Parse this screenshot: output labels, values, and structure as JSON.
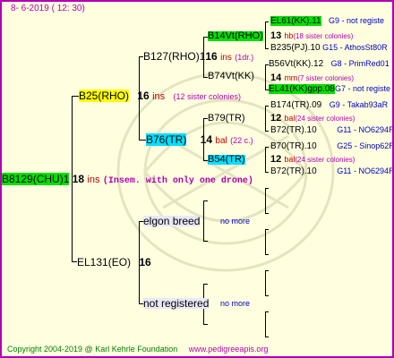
{
  "header": {
    "date": "8-  6-2019 ( 12:  30)"
  },
  "footer": {
    "copyright": "Copyright 2004-2019 @ Karl Kehrle Foundation",
    "site": "www.pedigreeapis.org"
  },
  "colors": {
    "frame": "#b000b0",
    "background": "#ffffe0",
    "highlight_green": "#00e000",
    "highlight_yellow": "#ffff00",
    "highlight_cyan": "#00e0ff",
    "link_blue": "#0000c0"
  },
  "root": {
    "id": "B8129(CHU)1",
    "num": "18",
    "ins": "ins",
    "note": "(Insem. with only one drone)"
  },
  "queen": {
    "id": "B25(RHO)",
    "num": "16",
    "ins": "ins",
    "note": "(12 sister colonies)"
  },
  "gen3": {
    "b127": {
      "id": "B127(RHO)1",
      "num": "16",
      "ins": "ins",
      "note": "(1dr.)"
    },
    "b76": {
      "id": "B76(TR)",
      "num": "14",
      "ins": "bal",
      "note": "(22 c.)"
    },
    "elgon": {
      "id": "elgon breed",
      "more": "no more"
    },
    "notreg": {
      "id": "not registered",
      "more": "no more"
    }
  },
  "ec131": {
    "id": "EL131(EO)",
    "num": "16"
  },
  "gen4": {
    "b14vt": {
      "id": "B14Vt(RHO)",
      "num": "13",
      "ins": "hb",
      "note": "(18 sister colonies)"
    },
    "b74vt": {
      "id": "B74Vt(KK)",
      "num": "14",
      "ins": "mm",
      "note": "(7 sister colonies)"
    },
    "b79": {
      "id": "B79(TR)",
      "num": "12",
      "ins": "bal",
      "note": "(24 sister colonies)"
    },
    "b54": {
      "id": "B54(TR)",
      "num": "12",
      "ins": "bal",
      "note": "(24 sister colonies)"
    }
  },
  "gen5": [
    {
      "id": "EL61(KK).11",
      "link": "G9 - not registe"
    },
    {
      "id": "B235(PJ).10",
      "link": "G15 - AthosSt80R"
    },
    {
      "id": "B56Vt(KK).12",
      "link": "G8 - PrimRed01"
    },
    {
      "id": "EL41(KK)gpp.08",
      "link": "G7 - not registe"
    },
    {
      "id": "B174(TR).09",
      "link": "G9 - Takab93aR"
    },
    {
      "id": "B72(TR).10",
      "link": "G11 - NO6294R"
    },
    {
      "id": "B70(TR).10",
      "link": "G25 - Sinop62R"
    },
    {
      "id": "B72(TR).10",
      "link": "G11 - NO6294R"
    }
  ]
}
